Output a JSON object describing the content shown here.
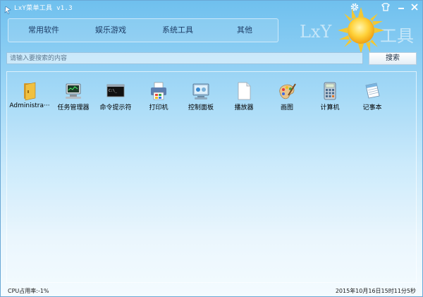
{
  "window": {
    "title": "LxY菜单工具 v1.3"
  },
  "brand": {
    "text_left": "LxY",
    "text_right": "工具"
  },
  "tabs": [
    {
      "label": "常用软件"
    },
    {
      "label": "娱乐游戏"
    },
    {
      "label": "系统工具"
    },
    {
      "label": "其他"
    }
  ],
  "search": {
    "placeholder": "请输入要搜索的内容",
    "button": "搜索"
  },
  "apps": [
    {
      "label": "Administra···",
      "icon": "folder-icon"
    },
    {
      "label": "任务管理器",
      "icon": "task-manager-icon"
    },
    {
      "label": "命令提示符",
      "icon": "command-prompt-icon"
    },
    {
      "label": "打印机",
      "icon": "printer-icon"
    },
    {
      "label": "控制面板",
      "icon": "control-panel-icon"
    },
    {
      "label": "播放器",
      "icon": "player-icon"
    },
    {
      "label": "画图",
      "icon": "paint-icon"
    },
    {
      "label": "计算机",
      "icon": "calculator-icon"
    },
    {
      "label": "记事本",
      "icon": "notepad-icon"
    }
  ],
  "status": {
    "cpu": "CPU占用率:-1%",
    "datetime": "2015年10月16日15时11分5秒"
  },
  "colors": {
    "accent": "#6fc0ee",
    "sun": "#ffd23a"
  }
}
